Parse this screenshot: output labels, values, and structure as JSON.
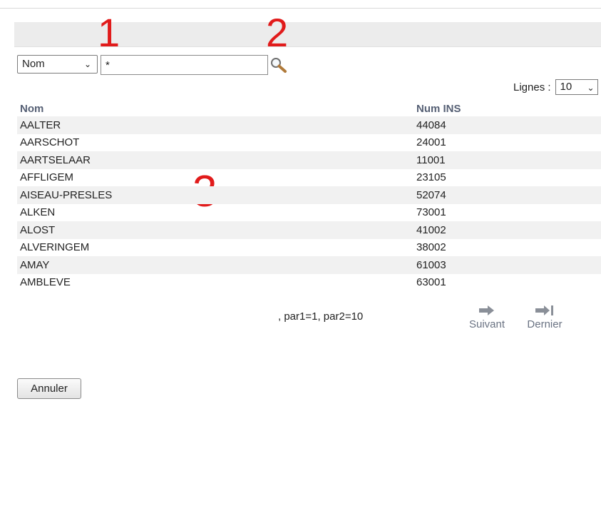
{
  "search": {
    "field_selected": "Nom",
    "query_value": "*",
    "button_icon": "magnifier-icon"
  },
  "annotations": [
    "1",
    "2",
    "3"
  ],
  "rows_per_page": {
    "label": "Lignes :",
    "selected": "10"
  },
  "table": {
    "columns": [
      "Nom",
      "Num INS"
    ],
    "rows": [
      [
        "AALTER",
        "44084"
      ],
      [
        "AARSCHOT",
        "24001"
      ],
      [
        "AARTSELAAR",
        "11001"
      ],
      [
        "AFFLIGEM",
        "23105"
      ],
      [
        "AISEAU-PRESLES",
        "52074"
      ],
      [
        "ALKEN",
        "73001"
      ],
      [
        "ALOST",
        "41002"
      ],
      [
        "ALVERINGEM",
        "38002"
      ],
      [
        "AMAY",
        "61003"
      ],
      [
        "AMBLEVE",
        "63001"
      ]
    ]
  },
  "pager": {
    "params_text": ", par1=1, par2=10",
    "next_label": "Suivant",
    "next_icon": "arrow-right-icon",
    "last_label": "Dernier",
    "last_icon": "arrow-last-icon"
  },
  "actions": {
    "cancel_label": "Annuler"
  },
  "colors": {
    "annotation": "#e11b1b",
    "header_text": "#555f74",
    "stripe": "#f1f1f1",
    "pager_icon": "#8a8f98"
  }
}
